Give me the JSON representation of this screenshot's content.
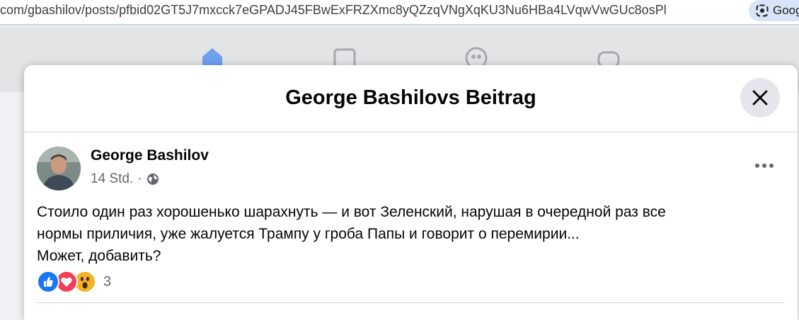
{
  "browser": {
    "url": "com/gbashilov/posts/pfbid02GT5J7mxcck7eGPADJ45FBwExFRZXmc8yQZzqVNgXqKU3Nu6HBa4LVqwVwGUc8osPl",
    "lens_label": "Goog"
  },
  "nav": {
    "icons": [
      "home-icon",
      "marketplace-icon",
      "groups-icon",
      "gaming-icon"
    ],
    "accent": "#1877f2"
  },
  "modal": {
    "title": "George Bashilovs Beitrag"
  },
  "post": {
    "author": "George Bashilov",
    "time": "14 Std.",
    "separator": "·",
    "privacy_icon": "globe-icon",
    "text_lines": [
      "Стоило один раз хорошенько шарахнуть  — и вот Зеленский, нарушая в очередной раз все",
      "нормы приличия, уже жалуется Трампу у гроба Папы и говорит о перемирии...",
      "Может, добавить?"
    ],
    "reactions": {
      "types": [
        "like",
        "love",
        "wow"
      ],
      "count": "3"
    }
  }
}
